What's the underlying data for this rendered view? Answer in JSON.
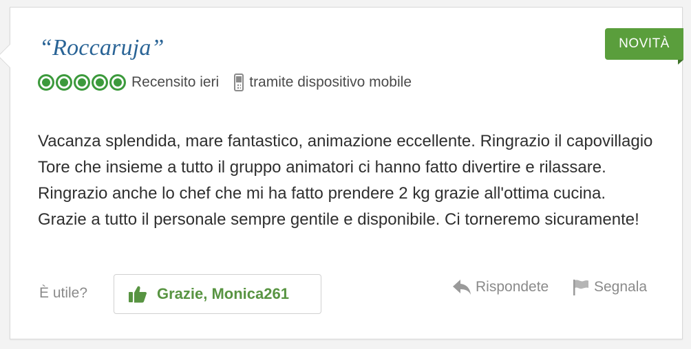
{
  "review": {
    "title": "“Roccaruja”",
    "badge": "NOVITÀ",
    "rating": 5,
    "reviewed_when": "Recensito ieri",
    "via": "tramite dispositivo mobile",
    "text": "Vacanza splendida, mare fantastico, animazione eccellente. Ringrazio il capovillagio Tore che insieme a tutto il gruppo animatori ci hanno fatto divertire e rilassare. Ringrazio anche lo chef che mi ha fatto prendere 2 kg grazie all'ottima cucina. Grazie a tutto il personale sempre gentile e disponibile. Ci torneremo sicuramente!"
  },
  "actions": {
    "useful_label": "È utile?",
    "thanks_label": "Grazie, Monica261",
    "reply_label": "Rispondete",
    "flag_label": "Segnala"
  },
  "icons": {
    "rating": "bubble-rating-icon",
    "mobile": "mobile-phone-icon",
    "thumb": "thumbs-up-icon",
    "reply": "reply-arrow-icon",
    "flag": "flag-icon"
  },
  "colors": {
    "title": "#2a6496",
    "badge": "#5a9e3c",
    "rating": "#3c9a3c",
    "thanks": "#589442"
  }
}
